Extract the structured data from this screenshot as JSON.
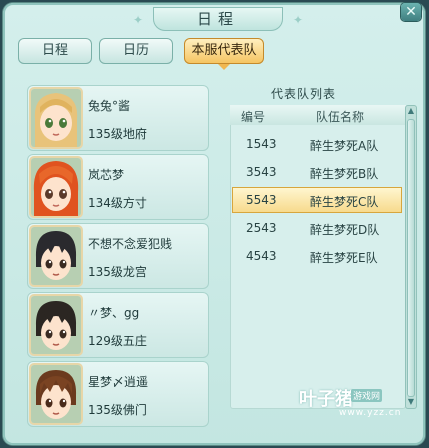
{
  "window": {
    "title": "日程"
  },
  "tabs": [
    {
      "label": "日程",
      "active": false
    },
    {
      "label": "日历",
      "active": false
    },
    {
      "label": "本服代表队",
      "active": true
    }
  ],
  "players": [
    {
      "name": "兔兔°酱",
      "level": "135级地府",
      "portrait": "blonde-girl-portrait"
    },
    {
      "name": "岚芯梦",
      "level": "134级方寸",
      "portrait": "redhead-girl-portrait"
    },
    {
      "name": "不想不念爱犯贱",
      "level": "135级龙宫",
      "portrait": "dark-hair-boy-portrait"
    },
    {
      "name": "〃梦、gg",
      "level": "129级五庄",
      "portrait": "dark-hair-boy-portrait"
    },
    {
      "name": "星梦〆逍遥",
      "level": "135级佛门",
      "portrait": "brown-hair-boy-portrait"
    }
  ],
  "team_list": {
    "title": "代表队列表",
    "headers": {
      "number": "编号",
      "team_name": "队伍名称"
    },
    "rows": [
      {
        "number": "1543",
        "team_name": "醉生梦死A队",
        "selected": false
      },
      {
        "number": "3543",
        "team_name": "醉生梦死B队",
        "selected": false
      },
      {
        "number": "5543",
        "team_name": "醉生梦死C队",
        "selected": true
      },
      {
        "number": "2543",
        "team_name": "醉生梦死D队",
        "selected": false
      },
      {
        "number": "4543",
        "team_name": "醉生梦死E队",
        "selected": false
      }
    ]
  },
  "watermark": {
    "brand": "叶子猪",
    "tag": "游戏网",
    "url": "www.yzz.cn"
  },
  "colors": {
    "panel": "#c3e6e1",
    "active_tab": "#f5c35e",
    "selected_row": "#f7d98a"
  }
}
